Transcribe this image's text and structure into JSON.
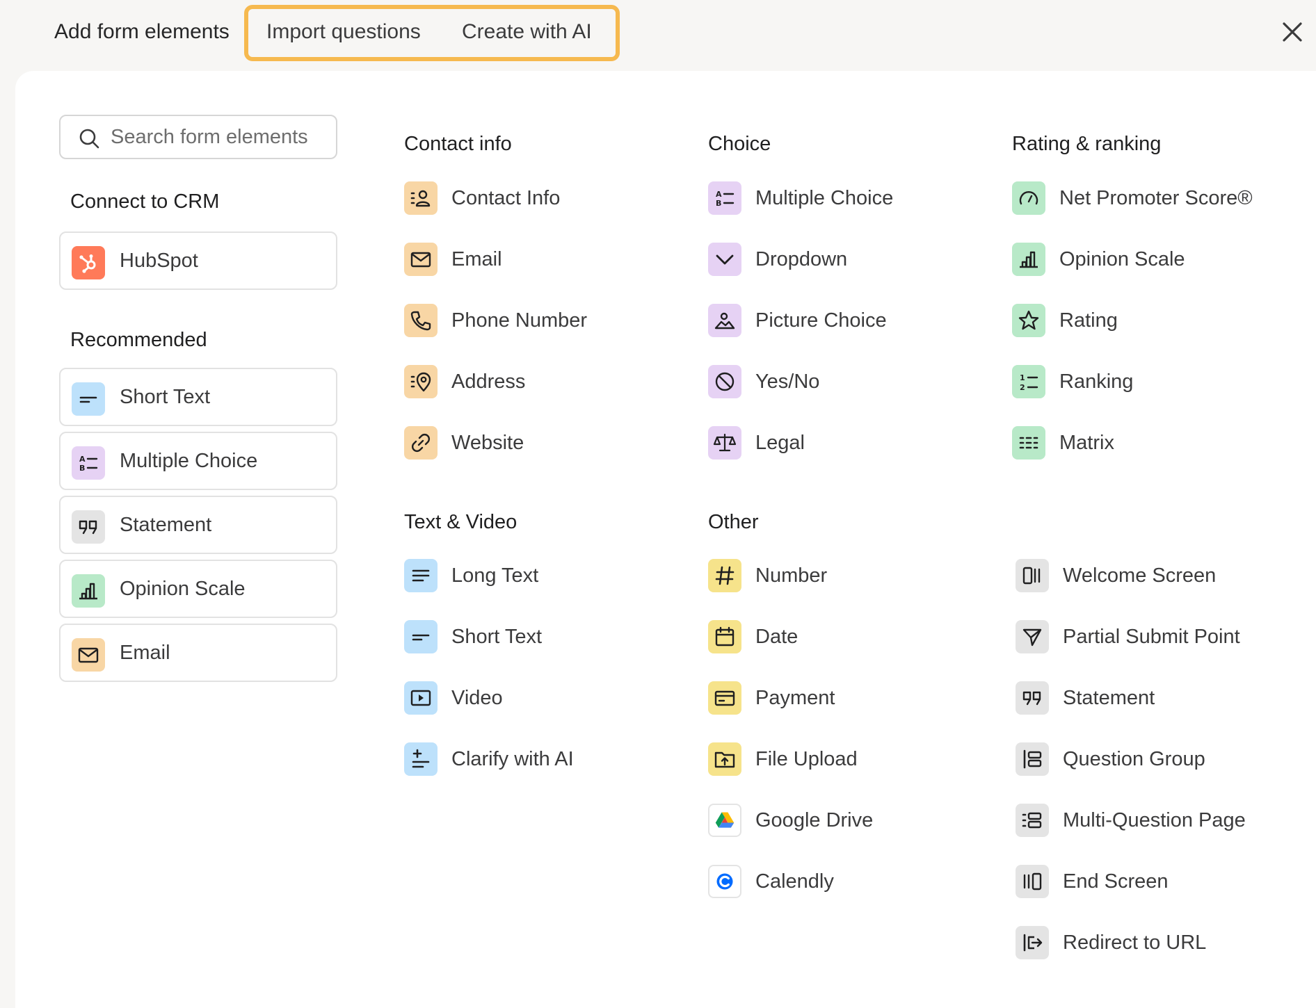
{
  "header": {
    "tabs": [
      "Add form elements",
      "Import questions",
      "Create with AI"
    ]
  },
  "search": {
    "placeholder": "Search form elements"
  },
  "sections": {
    "connect_crm": "Connect to CRM",
    "recommended": "Recommended",
    "contact_info": "Contact info",
    "choice": "Choice",
    "rating_ranking": "Rating & ranking",
    "text_video": "Text & Video",
    "other": "Other"
  },
  "crm": [
    {
      "label": "HubSpot",
      "icon": "hubspot-icon"
    }
  ],
  "recommended": [
    {
      "label": "Short Text",
      "icon": "short-text-icon",
      "color": "#bde1fb"
    },
    {
      "label": "Multiple Choice",
      "icon": "multiple-choice-icon",
      "color": "#e6d2f4"
    },
    {
      "label": "Statement",
      "icon": "quote-icon",
      "color": "#e4e4e4"
    },
    {
      "label": "Opinion Scale",
      "icon": "bar-chart-icon",
      "color": "#b8e9c8"
    },
    {
      "label": "Email",
      "icon": "mail-icon",
      "color": "#f8d6a5"
    }
  ],
  "contact_info": [
    {
      "label": "Contact Info",
      "icon": "contact-card-icon"
    },
    {
      "label": "Email",
      "icon": "mail-icon"
    },
    {
      "label": "Phone Number",
      "icon": "phone-icon"
    },
    {
      "label": "Address",
      "icon": "map-pin-icon"
    },
    {
      "label": "Website",
      "icon": "link-icon"
    }
  ],
  "choice": [
    {
      "label": "Multiple Choice",
      "icon": "multiple-choice-icon"
    },
    {
      "label": "Dropdown",
      "icon": "chevron-down-icon"
    },
    {
      "label": "Picture Choice",
      "icon": "picture-icon"
    },
    {
      "label": "Yes/No",
      "icon": "yes-no-icon"
    },
    {
      "label": "Legal",
      "icon": "scales-icon"
    }
  ],
  "rating_ranking": [
    {
      "label": "Net Promoter Score®",
      "icon": "gauge-icon"
    },
    {
      "label": "Opinion Scale",
      "icon": "bar-chart-icon"
    },
    {
      "label": "Rating",
      "icon": "star-icon"
    },
    {
      "label": "Ranking",
      "icon": "ordered-list-icon"
    },
    {
      "label": "Matrix",
      "icon": "matrix-icon"
    }
  ],
  "text_video": [
    {
      "label": "Long Text",
      "icon": "long-text-icon"
    },
    {
      "label": "Short Text",
      "icon": "short-text-icon"
    },
    {
      "label": "Video",
      "icon": "video-icon"
    },
    {
      "label": "Clarify with AI",
      "icon": "ai-clarify-icon"
    }
  ],
  "other": [
    {
      "label": "Number",
      "icon": "hash-icon"
    },
    {
      "label": "Date",
      "icon": "calendar-icon"
    },
    {
      "label": "Payment",
      "icon": "credit-card-icon"
    },
    {
      "label": "File Upload",
      "icon": "folder-upload-icon"
    },
    {
      "label": "Google Drive",
      "icon": "google-drive-icon"
    },
    {
      "label": "Calendly",
      "icon": "calendly-icon"
    }
  ],
  "structure": [
    {
      "label": "Welcome Screen",
      "icon": "welcome-screen-icon"
    },
    {
      "label": "Partial Submit Point",
      "icon": "send-icon"
    },
    {
      "label": "Statement",
      "icon": "quote-icon"
    },
    {
      "label": "Question Group",
      "icon": "question-group-icon"
    },
    {
      "label": "Multi-Question Page",
      "icon": "multi-question-icon"
    },
    {
      "label": "End Screen",
      "icon": "end-screen-icon"
    },
    {
      "label": "Redirect to URL",
      "icon": "redirect-icon"
    }
  ],
  "colors": {
    "highlight": "#f6b94f",
    "contact": "#f8d6a5",
    "choice": "#e6d2f4",
    "rating": "#b8e9c8",
    "text_video": "#bde1fb",
    "other": "#f6e38b",
    "structure": "#e4e4e4",
    "hubspot": "#ff7a59"
  }
}
